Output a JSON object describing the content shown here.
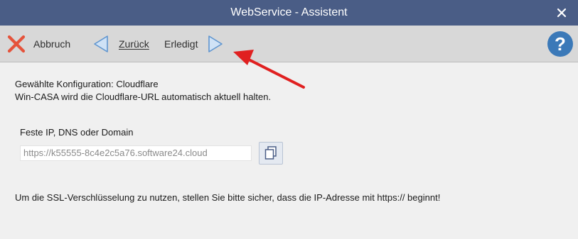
{
  "window": {
    "title": "WebService - Assistent",
    "title_bar_color": "#4a5d86"
  },
  "toolbar": {
    "cancel_label": "Abbruch",
    "back_label": "Zurück",
    "done_label": "Erledigt",
    "icons": {
      "cancel": "red-x-icon",
      "back": "arrow-left-icon",
      "forward": "arrow-right-icon",
      "help": "question-mark-icon"
    }
  },
  "content": {
    "config_line": "Gewählte Konfiguration: Cloudflare",
    "info_line": "Win-CASA wird die Cloudflare-URL automatisch aktuell halten.",
    "field_label": "Feste IP, DNS oder Domain",
    "field_value": "https://k55555-8c4e2c5a76.software24.cloud",
    "copy_icon": "copy-icon",
    "ssl_note": "Um die SSL-Verschlüsselung zu nutzen, stellen Sie bitte sicher, dass die IP-Adresse mit https:// beginnt!"
  },
  "annotation": {
    "arrow_color": "#e02020"
  }
}
